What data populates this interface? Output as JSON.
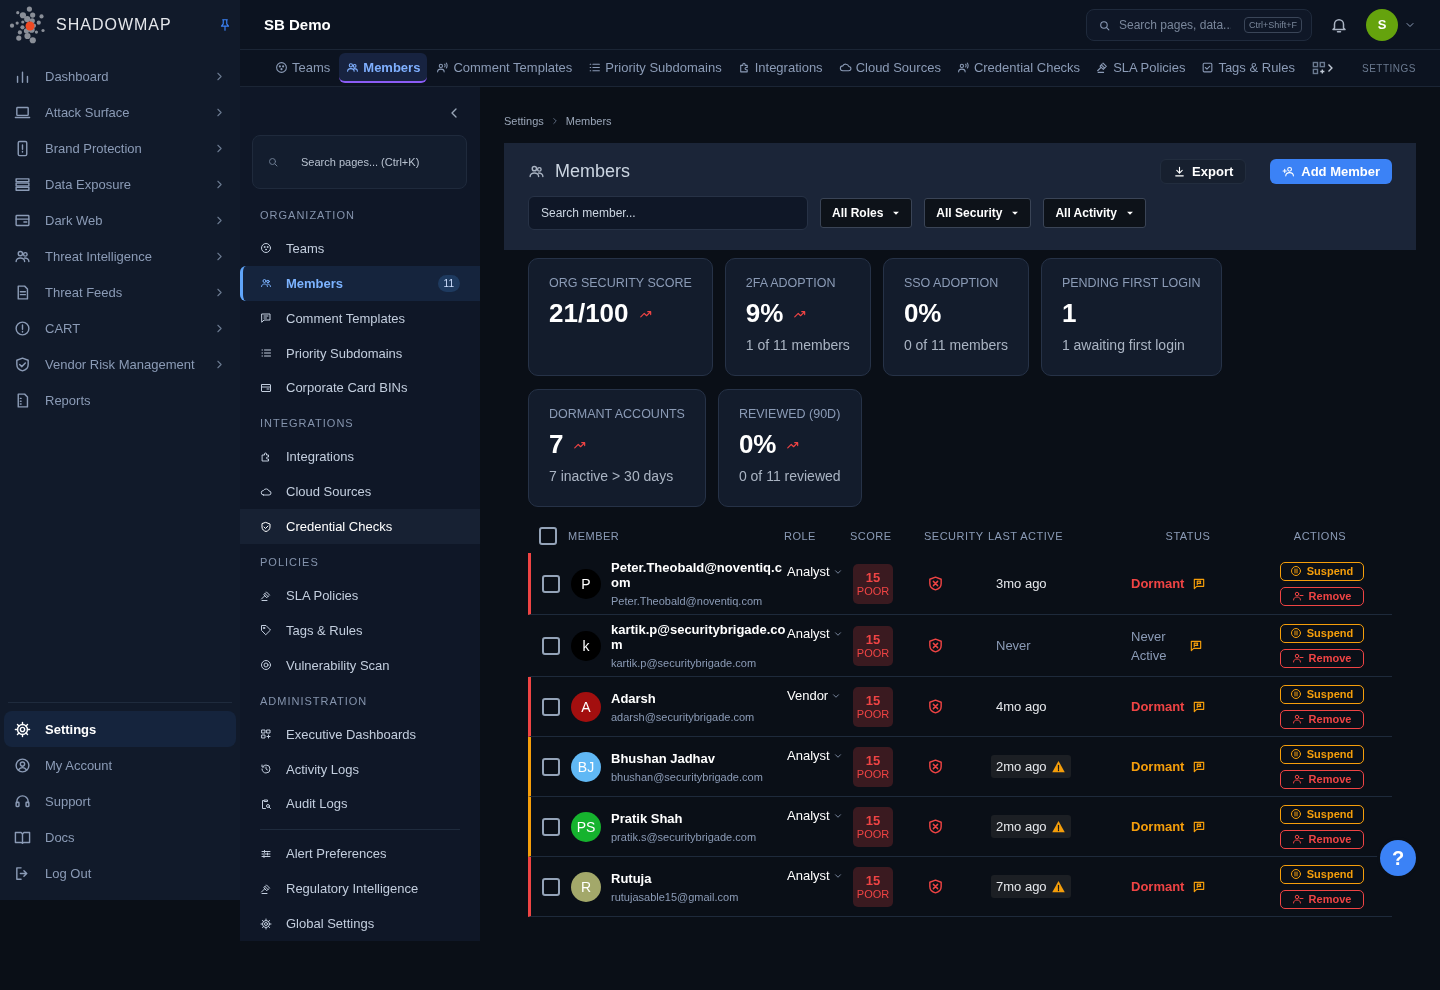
{
  "brand": {
    "name": "SHADOWMAP"
  },
  "sidebar": {
    "items": [
      {
        "label": "Dashboard",
        "expandable": true,
        "selected": false
      },
      {
        "label": "Attack Surface",
        "expandable": true,
        "selected": false
      },
      {
        "label": "Brand Protection",
        "expandable": true,
        "selected": false
      },
      {
        "label": "Data Exposure",
        "expandable": true,
        "selected": false
      },
      {
        "label": "Dark Web",
        "expandable": true,
        "selected": false
      },
      {
        "label": "Threat Intelligence",
        "expandable": true,
        "selected": false
      },
      {
        "label": "Threat Feeds",
        "expandable": true,
        "selected": false
      },
      {
        "label": "CART",
        "expandable": true,
        "selected": false
      },
      {
        "label": "Vendor Risk Management",
        "expandable": true,
        "selected": false
      },
      {
        "label": "Reports",
        "expandable": false,
        "selected": false
      }
    ],
    "footer_items": [
      {
        "label": "Settings",
        "selected": true
      },
      {
        "label": "My Account",
        "selected": false
      },
      {
        "label": "Support",
        "selected": false
      },
      {
        "label": "Docs",
        "selected": false
      },
      {
        "label": "Log Out",
        "selected": false
      }
    ]
  },
  "header": {
    "title": "SB Demo",
    "search": {
      "placeholder": "Search pages, data...",
      "shortcut": "Ctrl+Shift+F"
    },
    "avatar": "S"
  },
  "tabs": [
    {
      "label": "Teams",
      "selected": false
    },
    {
      "label": "Members",
      "selected": true
    },
    {
      "label": "Comment Templates",
      "selected": false
    },
    {
      "label": "Priority Subdomains",
      "selected": false
    },
    {
      "label": "Integrations",
      "selected": false
    },
    {
      "label": "Cloud Sources",
      "selected": false
    },
    {
      "label": "Credential Checks",
      "selected": false
    },
    {
      "label": "SLA Policies",
      "selected": false
    },
    {
      "label": "Tags & Rules",
      "selected": false
    }
  ],
  "tabs_caption": "SETTINGS",
  "settings_nav": {
    "search": {
      "placeholder": "Search pages... (Ctrl+K)"
    },
    "sections": [
      {
        "title": "ORGANIZATION",
        "items": [
          {
            "label": "Teams",
            "selected": false,
            "hovered": false
          },
          {
            "label": "Members",
            "selected": true,
            "hovered": false,
            "count": "11"
          },
          {
            "label": "Comment Templates",
            "selected": false,
            "hovered": false
          },
          {
            "label": "Priority Subdomains",
            "selected": false,
            "hovered": false
          },
          {
            "label": "Corporate Card BINs",
            "selected": false,
            "hovered": false
          }
        ]
      },
      {
        "title": "INTEGRATIONS",
        "items": [
          {
            "label": "Integrations",
            "selected": false,
            "hovered": false
          },
          {
            "label": "Cloud Sources",
            "selected": false,
            "hovered": false
          },
          {
            "label": "Credential Checks",
            "selected": false,
            "hovered": true
          }
        ]
      },
      {
        "title": "POLICIES",
        "items": [
          {
            "label": "SLA Policies",
            "selected": false,
            "hovered": false
          },
          {
            "label": "Tags & Rules",
            "selected": false,
            "hovered": false
          },
          {
            "label": "Vulnerability Scan",
            "selected": false,
            "hovered": false
          }
        ]
      },
      {
        "title": "ADMINISTRATION",
        "items": [
          {
            "label": "Executive Dashboards",
            "selected": false,
            "hovered": false
          },
          {
            "label": "Activity Logs",
            "selected": false,
            "hovered": false
          },
          {
            "label": "Audit Logs",
            "selected": false,
            "hovered": false
          }
        ]
      },
      {
        "items": [
          {
            "label": "Alert Preferences",
            "selected": false,
            "hovered": false
          },
          {
            "label": "Regulatory Intelligence",
            "selected": false,
            "hovered": false
          },
          {
            "label": "Global Settings",
            "selected": false,
            "hovered": false
          }
        ]
      }
    ]
  },
  "breadcrumb": [
    {
      "label": "Settings"
    },
    {
      "label": "Members"
    }
  ],
  "members_panel": {
    "title": "Members",
    "buttons": [
      {
        "label": "Export",
        "kind": "secondary"
      },
      {
        "label": "Add Member",
        "kind": "primary"
      }
    ],
    "search": {
      "placeholder": "Search member..."
    },
    "filters": [
      {
        "label": "All Roles"
      },
      {
        "label": "All Security"
      },
      {
        "label": "All Activity"
      }
    ]
  },
  "stat_rows": [
    [
      {
        "label": "ORG SECURITY SCORE",
        "value": "21/100",
        "trend": true
      },
      {
        "label": "2FA ADOPTION",
        "value": "9%",
        "trend": true,
        "note": "1 of 11 members"
      },
      {
        "label": "SSO ADOPTION",
        "value": "0%",
        "trend": false,
        "note": "0 of 11 members"
      },
      {
        "label": "PENDING FIRST LOGIN",
        "value": "1",
        "trend": false,
        "note": "1 awaiting first login"
      }
    ],
    [
      {
        "label": "DORMANT ACCOUNTS",
        "value": "7",
        "trend": true,
        "note": "7 inactive > 30 days"
      },
      {
        "label": "REVIEWED (90D)",
        "value": "0%",
        "trend": true,
        "note": "0 of 11 reviewed"
      }
    ]
  ],
  "table": {
    "select_all": {
      "checked": false
    },
    "columns": [
      "MEMBER",
      "ROLE",
      "SCORE",
      "SECURITY",
      "LAST ACTIVE",
      "STATUS",
      "ACTIONS"
    ],
    "rows": [
      {
        "checked": false,
        "avatar": "P",
        "color": "#000000",
        "name": "Peter.Theobald@noventiq.com",
        "email": "Peter.Theobald@noventiq.com",
        "role": "Analyst",
        "score": "15",
        "grade": "POOR",
        "last_active": "3mo ago",
        "stale": false,
        "status": "Dormant",
        "kind": "critical",
        "actions": [
          "Suspend",
          "Remove"
        ]
      },
      {
        "checked": false,
        "avatar": "k",
        "color": "#000000",
        "name": "kartik.p@securitybrigade.com",
        "email": "kartik.p@securitybrigade.com",
        "role": "Analyst",
        "score": "15",
        "grade": "POOR",
        "last_active": "Never",
        "stale": false,
        "status": "Never Active",
        "kind": "inactive",
        "actions": [
          "Suspend",
          "Remove"
        ]
      },
      {
        "checked": false,
        "avatar": "A",
        "color": "#a30f0f",
        "name": "Adarsh",
        "email": "adarsh@securitybrigade.com",
        "role": "Vendor",
        "score": "15",
        "grade": "POOR",
        "last_active": "4mo ago",
        "stale": false,
        "status": "Dormant",
        "kind": "critical",
        "actions": [
          "Suspend",
          "Remove"
        ]
      },
      {
        "checked": false,
        "avatar": "BJ",
        "color": "#60b8f5",
        "name": "Bhushan Jadhav",
        "email": "bhushan@securitybrigade.com",
        "role": "Analyst",
        "score": "15",
        "grade": "POOR",
        "last_active": "2mo ago",
        "stale": true,
        "status": "Dormant",
        "kind": "warning",
        "actions": [
          "Suspend",
          "Remove"
        ]
      },
      {
        "checked": false,
        "avatar": "PS",
        "color": "#16b32e",
        "name": "Pratik Shah",
        "email": "pratik.s@securitybrigade.com",
        "role": "Analyst",
        "score": "15",
        "grade": "POOR",
        "last_active": "2mo ago",
        "stale": true,
        "status": "Dormant",
        "kind": "warning",
        "actions": [
          "Suspend",
          "Remove"
        ]
      },
      {
        "checked": false,
        "avatar": "R",
        "color": "#a3a86a",
        "name": "Rutuja",
        "email": "rutujasable15@gmail.com",
        "role": "Analyst",
        "score": "15",
        "grade": "POOR",
        "last_active": "7mo ago",
        "stale": true,
        "status": "Dormant",
        "kind": "critical",
        "actions": [
          "Suspend",
          "Remove"
        ]
      }
    ]
  },
  "help_button": {
    "label": "?"
  }
}
